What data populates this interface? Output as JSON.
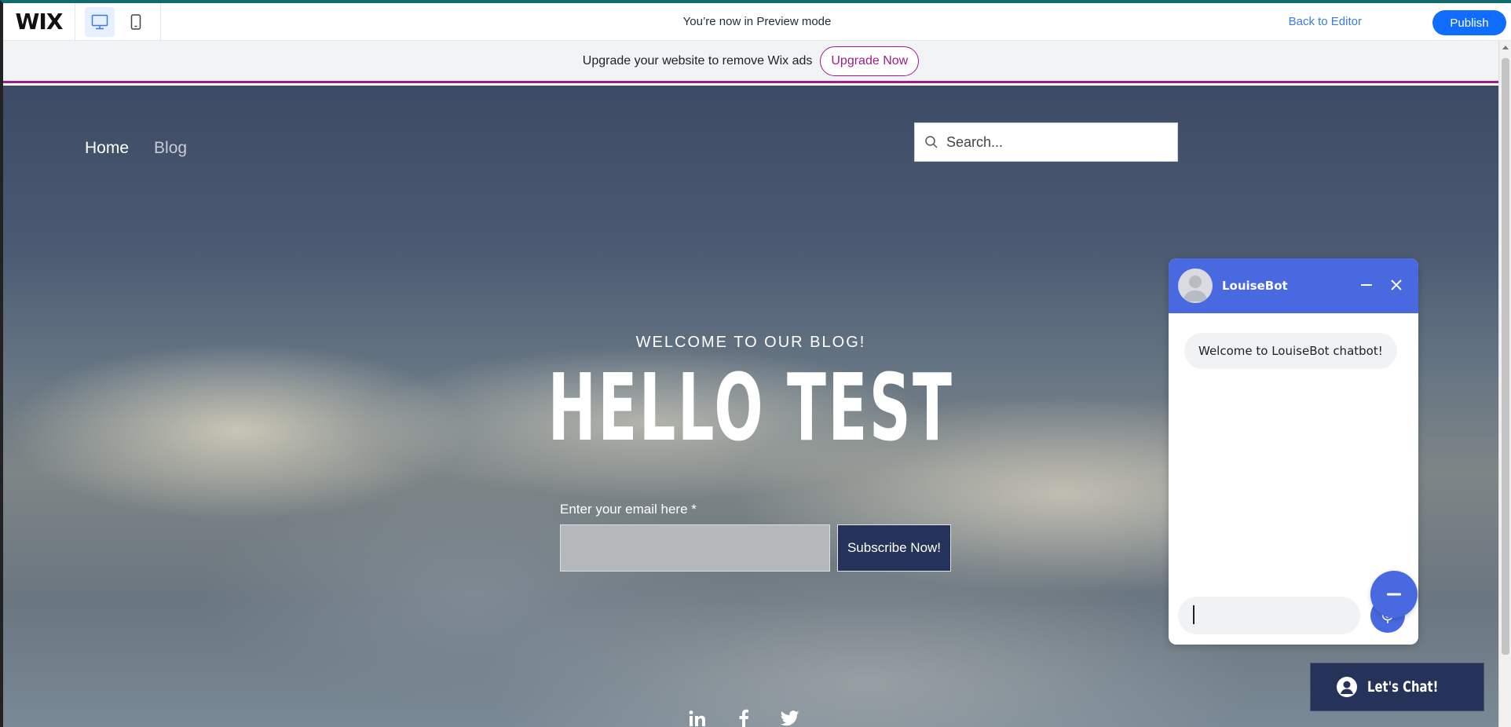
{
  "topbar": {
    "logo": "WIX",
    "preview_text": "You’re now in Preview mode",
    "back_to_editor": "Back to Editor",
    "publish": "Publish"
  },
  "upgrade": {
    "text": "Upgrade your website to remove Wix ads",
    "button": "Upgrade Now"
  },
  "site": {
    "nav": {
      "home": "Home",
      "blog": "Blog"
    },
    "search": {
      "placeholder": "Search..."
    },
    "hero": {
      "subtitle": "WELCOME TO OUR BLOG!",
      "title": "HELLO TEST",
      "email_label": "Enter your email here *",
      "subscribe": "Subscribe Now!"
    },
    "socials": [
      "linkedin-icon",
      "facebook-icon",
      "twitter-icon"
    ]
  },
  "chat": {
    "bot_name": "LouiseBot",
    "welcome": "Welcome to LouiseBot chatbot!",
    "input_value": "",
    "lets_chat": "Let's Chat!",
    "accent_color": "#4869e0"
  },
  "colors": {
    "publish": "#116dff",
    "upgrade_accent": "#9d1d8e",
    "subscribe_bg": "#25335a"
  }
}
